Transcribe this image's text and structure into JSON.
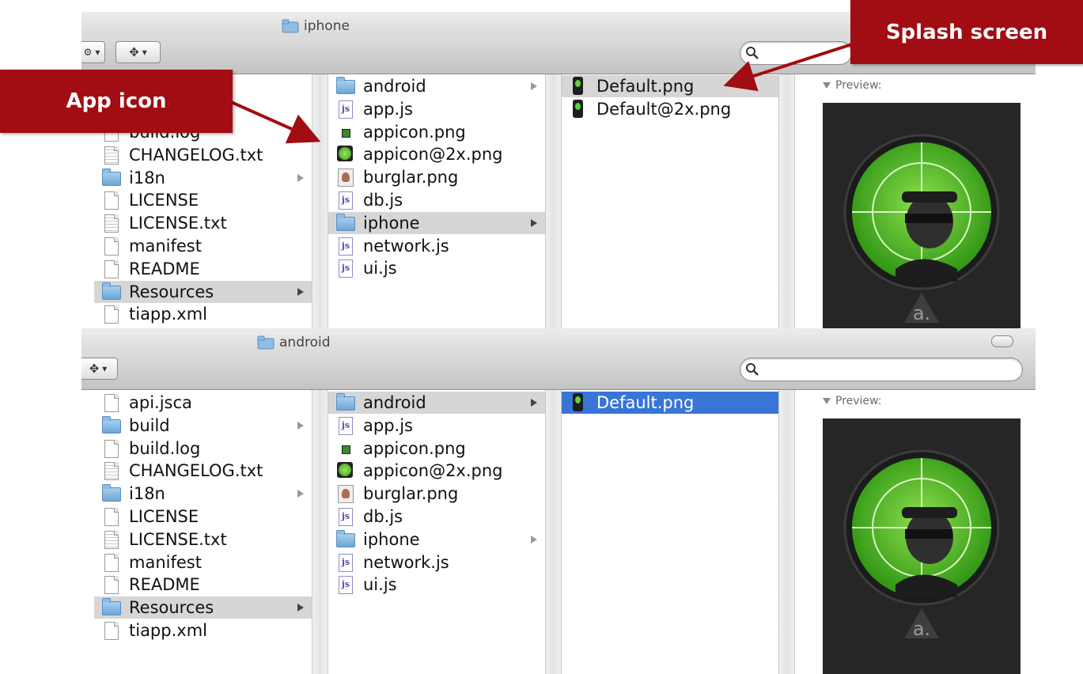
{
  "window_top": {
    "title": "iphone",
    "column1": [
      {
        "label": "build.log",
        "icon": "document-icon",
        "partial": true
      },
      {
        "label": "CHANGELOG.txt",
        "icon": "text-document-icon"
      },
      {
        "label": "i18n",
        "icon": "folder-icon",
        "arrow": true
      },
      {
        "label": "LICENSE",
        "icon": "document-icon"
      },
      {
        "label": "LICENSE.txt",
        "icon": "text-document-icon"
      },
      {
        "label": "manifest",
        "icon": "document-icon"
      },
      {
        "label": "README",
        "icon": "document-icon"
      },
      {
        "label": "Resources",
        "icon": "folder-icon",
        "arrow": true,
        "selected": "gray"
      },
      {
        "label": "tiapp.xml",
        "icon": "document-icon"
      }
    ],
    "column2": [
      {
        "label": "android",
        "icon": "folder-icon",
        "arrow": true
      },
      {
        "label": "app.js",
        "icon": "js-file-icon"
      },
      {
        "label": "appicon.png",
        "icon": "png-small-icon"
      },
      {
        "label": "appicon@2x.png",
        "icon": "png-large-icon"
      },
      {
        "label": "burglar.png",
        "icon": "burglar-icon"
      },
      {
        "label": "db.js",
        "icon": "js-file-icon"
      },
      {
        "label": "iphone",
        "icon": "folder-icon",
        "arrow": true,
        "selected": "gray"
      },
      {
        "label": "network.js",
        "icon": "js-file-icon"
      },
      {
        "label": "ui.js",
        "icon": "js-file-icon"
      }
    ],
    "column3": [
      {
        "label": "Default.png",
        "icon": "phone-image-icon",
        "selected": "gray"
      },
      {
        "label": "Default@2x.png",
        "icon": "phone-image-icon"
      }
    ],
    "preview_label": "Preview:"
  },
  "window_bottom": {
    "title": "android",
    "column1": [
      {
        "label": "api.jsca",
        "icon": "document-icon"
      },
      {
        "label": "build",
        "icon": "folder-icon",
        "arrow": true
      },
      {
        "label": "build.log",
        "icon": "document-icon"
      },
      {
        "label": "CHANGELOG.txt",
        "icon": "text-document-icon"
      },
      {
        "label": "i18n",
        "icon": "folder-icon",
        "arrow": true
      },
      {
        "label": "LICENSE",
        "icon": "document-icon"
      },
      {
        "label": "LICENSE.txt",
        "icon": "text-document-icon"
      },
      {
        "label": "manifest",
        "icon": "document-icon"
      },
      {
        "label": "README",
        "icon": "document-icon"
      },
      {
        "label": "Resources",
        "icon": "folder-icon",
        "arrow": true,
        "selected": "gray"
      },
      {
        "label": "tiapp.xml",
        "icon": "document-icon"
      }
    ],
    "column2": [
      {
        "label": "android",
        "icon": "folder-icon",
        "arrow": true,
        "selected": "gray"
      },
      {
        "label": "app.js",
        "icon": "js-file-icon"
      },
      {
        "label": "appicon.png",
        "icon": "png-small-icon"
      },
      {
        "label": "appicon@2x.png",
        "icon": "png-large-icon"
      },
      {
        "label": "burglar.png",
        "icon": "burglar-icon"
      },
      {
        "label": "db.js",
        "icon": "js-file-icon"
      },
      {
        "label": "iphone",
        "icon": "folder-icon",
        "arrow": true
      },
      {
        "label": "network.js",
        "icon": "js-file-icon"
      },
      {
        "label": "ui.js",
        "icon": "js-file-icon"
      }
    ],
    "column3": [
      {
        "label": "Default.png",
        "icon": "phone-image-icon",
        "selected": "blue"
      }
    ],
    "preview_label": "Preview:"
  },
  "callouts": {
    "app_icon": "App icon",
    "splash_screen": "Splash screen"
  },
  "colors": {
    "callout_bg": "#a10d12",
    "selection_blue": "#3875d7",
    "selection_gray": "#d6d6d6"
  }
}
